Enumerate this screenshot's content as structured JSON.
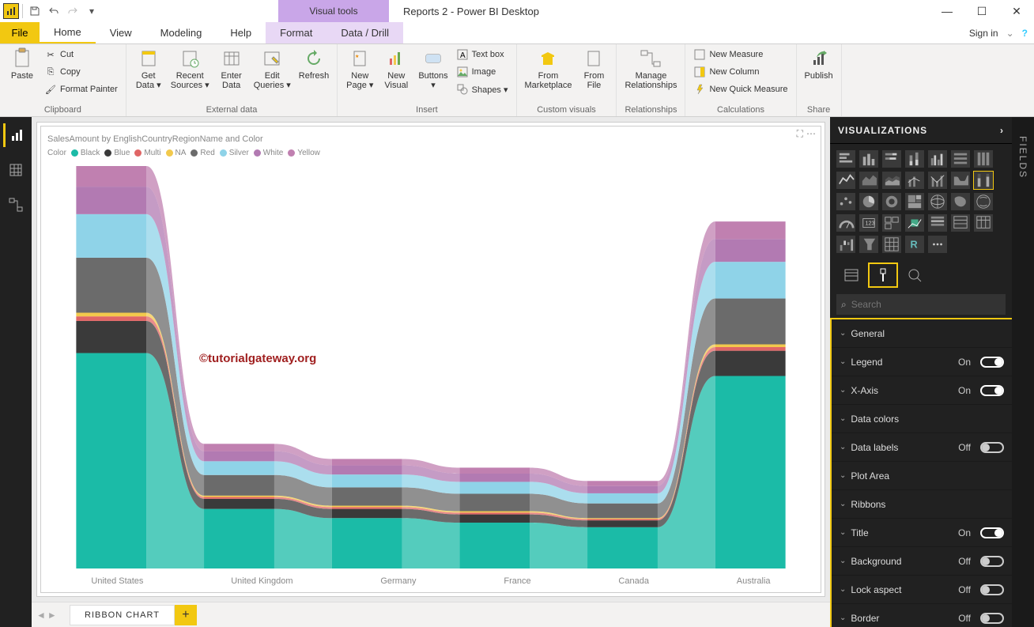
{
  "window": {
    "title": "Reports 2 - Power BI Desktop",
    "visual_tools": "Visual tools",
    "sign_in": "Sign in"
  },
  "tabs": {
    "file": "File",
    "list": [
      "Home",
      "View",
      "Modeling",
      "Help",
      "Format",
      "Data / Drill"
    ],
    "active": "Home"
  },
  "ribbon": {
    "clipboard": {
      "label": "Clipboard",
      "paste": "Paste",
      "cut": "Cut",
      "copy": "Copy",
      "format_painter": "Format Painter"
    },
    "external": {
      "label": "External data",
      "get_data": "Get\nData ▾",
      "recent": "Recent\nSources ▾",
      "enter": "Enter\nData",
      "edit_q": "Edit\nQueries ▾",
      "refresh": "Refresh"
    },
    "insert": {
      "label": "Insert",
      "new_page": "New\nPage ▾",
      "new_visual": "New\nVisual",
      "buttons": "Buttons\n▾",
      "text_box": "Text box",
      "image": "Image",
      "shapes": "Shapes ▾"
    },
    "custom": {
      "label": "Custom visuals",
      "marketplace": "From\nMarketplace",
      "file": "From\nFile"
    },
    "relationships": {
      "label": "Relationships",
      "manage": "Manage\nRelationships"
    },
    "calculations": {
      "label": "Calculations",
      "new_measure": "New Measure",
      "new_column": "New Column",
      "new_quick": "New Quick Measure"
    },
    "share": {
      "label": "Share",
      "publish": "Publish"
    }
  },
  "page_tab": {
    "name": "RIBBON CHART"
  },
  "chart_data": {
    "type": "ribbon",
    "title": "SalesAmount by EnglishCountryRegionName and Color",
    "legend_title": "Color",
    "categories": [
      "United States",
      "United Kingdom",
      "Germany",
      "France",
      "Canada",
      "Australia"
    ],
    "series": [
      {
        "name": "Black",
        "color": "#1bbba7",
        "values": [
          470,
          130,
          110,
          100,
          90,
          420
        ]
      },
      {
        "name": "Blue",
        "color": "#3a3a3a",
        "values": [
          70,
          22,
          20,
          18,
          15,
          55
        ]
      },
      {
        "name": "Multi",
        "color": "#e06666",
        "values": [
          10,
          4,
          4,
          4,
          3,
          8
        ]
      },
      {
        "name": "NA",
        "color": "#f2c94c",
        "values": [
          8,
          3,
          3,
          3,
          2,
          6
        ]
      },
      {
        "name": "Red",
        "color": "#6b6b6b",
        "values": [
          120,
          45,
          40,
          38,
          32,
          100
        ]
      },
      {
        "name": "Silver",
        "color": "#8fd3e8",
        "values": [
          95,
          30,
          28,
          26,
          22,
          80
        ]
      },
      {
        "name": "White",
        "color": "#b27ab2",
        "values": [
          60,
          22,
          20,
          18,
          16,
          50
        ]
      },
      {
        "name": "Yellow",
        "color": "#c080b0",
        "values": [
          45,
          16,
          14,
          13,
          11,
          38
        ]
      }
    ],
    "watermark": "©tutorialgateway.org"
  },
  "viz_panel": {
    "header": "VISUALIZATIONS",
    "fields_label": "FIELDS",
    "search_placeholder": "Search",
    "props": [
      {
        "label": "General",
        "state": null
      },
      {
        "label": "Legend",
        "state": "On"
      },
      {
        "label": "X-Axis",
        "state": "On"
      },
      {
        "label": "Data colors",
        "state": null
      },
      {
        "label": "Data labels",
        "state": "Off"
      },
      {
        "label": "Plot Area",
        "state": null
      },
      {
        "label": "Ribbons",
        "state": null
      },
      {
        "label": "Title",
        "state": "On"
      },
      {
        "label": "Background",
        "state": "Off"
      },
      {
        "label": "Lock aspect",
        "state": "Off"
      },
      {
        "label": "Border",
        "state": "Off"
      }
    ]
  }
}
